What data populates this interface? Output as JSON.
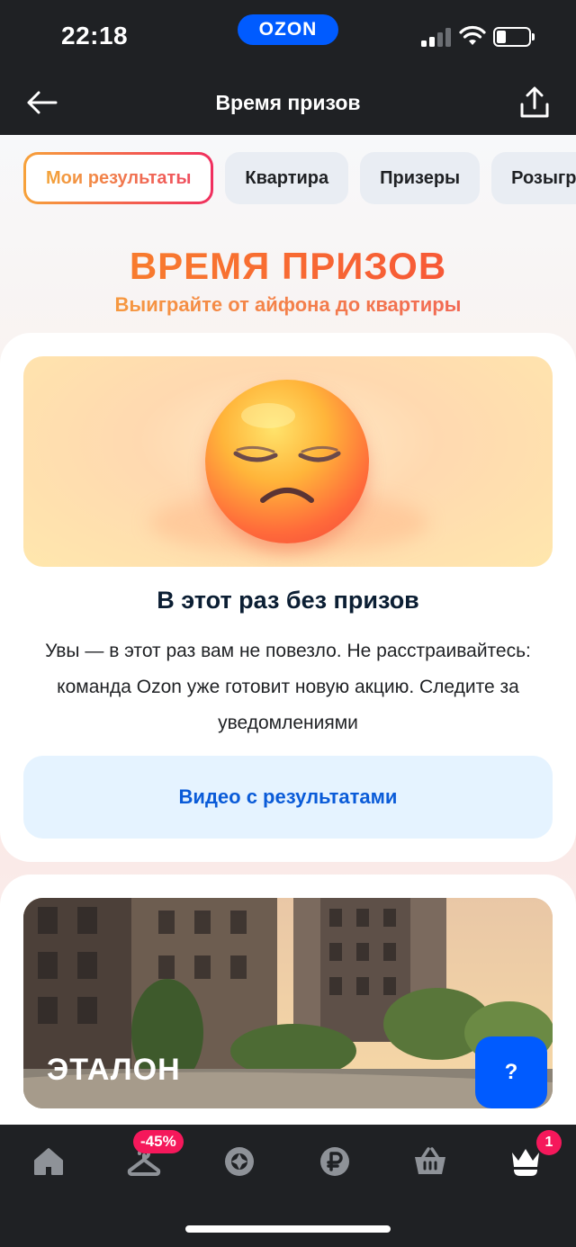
{
  "status_bar": {
    "time": "22:18",
    "brand": "OZON"
  },
  "header": {
    "title": "Время призов"
  },
  "tabs": [
    {
      "label": "Мои результаты",
      "active": true
    },
    {
      "label": "Квартира",
      "active": false
    },
    {
      "label": "Призеры",
      "active": false
    },
    {
      "label": "Розыгрыш",
      "active": false
    }
  ],
  "hero": {
    "title": "ВРЕМЯ ПРИЗОВ",
    "subtitle": "Выиграйте от айфона до квартиры"
  },
  "result_card": {
    "title": "В этот раз без призов",
    "text": "Увы — в этот раз вам не повезло. Не расстраивайтесь: команда Ozon уже готовит новую акцию. Следите за уведомлениями",
    "button": "Видео с результатами"
  },
  "promo": {
    "brand": "ЭТАЛОН"
  },
  "help": {
    "label": "?"
  },
  "bottom_nav": {
    "items": [
      {
        "name": "home",
        "icon": "home-icon"
      },
      {
        "name": "fresh",
        "icon": "hanger-icon"
      },
      {
        "name": "favorites",
        "icon": "wheel-icon"
      },
      {
        "name": "bank",
        "icon": "ruble-icon"
      },
      {
        "name": "cart",
        "icon": "basket-icon"
      },
      {
        "name": "profile",
        "icon": "crown-icon"
      }
    ],
    "discount_badge": "-45%",
    "profile_badge": "1"
  },
  "colors": {
    "accent": "#005bff",
    "badge": "#f5185b",
    "hero_orange": "#f86a2e",
    "button_bg": "#e5f3ff",
    "button_text": "#0a5bd8",
    "bar": "#1f2124"
  }
}
